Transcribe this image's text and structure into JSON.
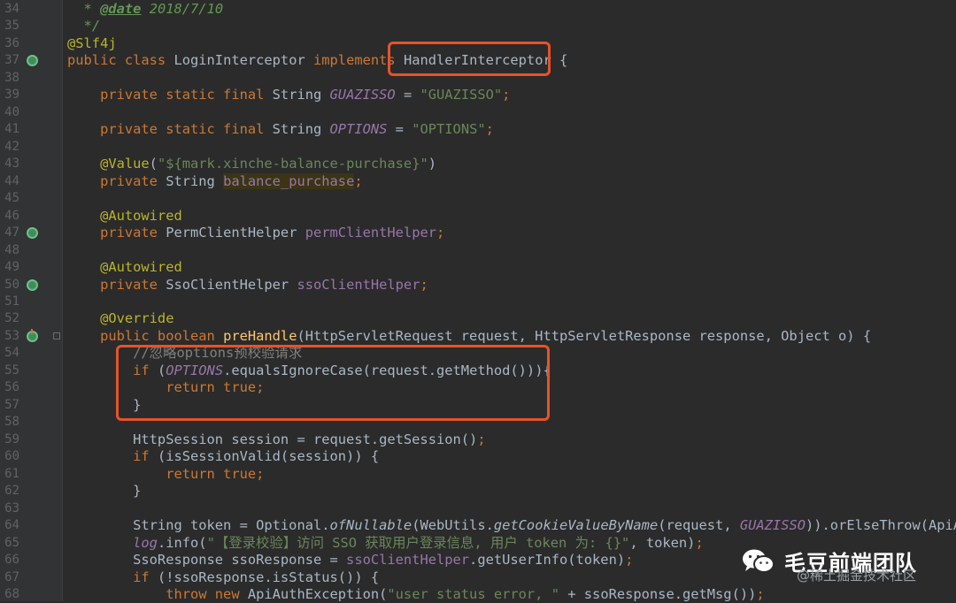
{
  "lines": [
    {
      "n": "34",
      "tokens": [
        {
          "t": "  ",
          "c": ""
        },
        {
          "t": "* ",
          "c": "doc"
        },
        {
          "t": "@date",
          "c": "doctag"
        },
        {
          "t": " 2018/7/10",
          "c": "doc"
        }
      ]
    },
    {
      "n": "35",
      "tokens": [
        {
          "t": "  ",
          "c": ""
        },
        {
          "t": "*/",
          "c": "doc"
        }
      ]
    },
    {
      "n": "36",
      "tokens": [
        {
          "t": "@Slf4j",
          "c": "ann"
        }
      ]
    },
    {
      "n": "37",
      "tokens": [
        {
          "t": "public class ",
          "c": "k"
        },
        {
          "t": "LoginInterceptor ",
          "c": ""
        },
        {
          "t": "implements ",
          "c": "k"
        },
        {
          "t": "HandlerInterceptor",
          "c": ""
        },
        {
          "t": " {",
          "c": ""
        }
      ]
    },
    {
      "n": "38",
      "tokens": []
    },
    {
      "n": "39",
      "tokens": [
        {
          "t": "    private static final ",
          "c": "k"
        },
        {
          "t": "String ",
          "c": ""
        },
        {
          "t": "GUAZISSO",
          "c": "sfld"
        },
        {
          "t": " = ",
          "c": ""
        },
        {
          "t": "\"GUAZISSO\"",
          "c": "str"
        },
        {
          "t": ";",
          "c": "k"
        }
      ]
    },
    {
      "n": "40",
      "tokens": []
    },
    {
      "n": "41",
      "tokens": [
        {
          "t": "    private static final ",
          "c": "k"
        },
        {
          "t": "String ",
          "c": ""
        },
        {
          "t": "OPTIONS",
          "c": "sfld"
        },
        {
          "t": " = ",
          "c": ""
        },
        {
          "t": "\"OPTIONS\"",
          "c": "str"
        },
        {
          "t": ";",
          "c": "k"
        }
      ]
    },
    {
      "n": "42",
      "tokens": []
    },
    {
      "n": "43",
      "tokens": [
        {
          "t": "    @Value",
          "c": "ann"
        },
        {
          "t": "(",
          "c": ""
        },
        {
          "t": "\"${mark.xinche-balance-purchase}\"",
          "c": "str"
        },
        {
          "t": ")",
          "c": ""
        }
      ]
    },
    {
      "n": "44",
      "tokens": [
        {
          "t": "    private ",
          "c": "k"
        },
        {
          "t": "String ",
          "c": ""
        },
        {
          "t": "balance_purchase",
          "c": "fld hl"
        },
        {
          "t": ";",
          "c": "k"
        }
      ]
    },
    {
      "n": "45",
      "tokens": []
    },
    {
      "n": "46",
      "tokens": [
        {
          "t": "    @Autowired",
          "c": "ann"
        }
      ]
    },
    {
      "n": "47",
      "tokens": [
        {
          "t": "    private ",
          "c": "k"
        },
        {
          "t": "PermClientHelper ",
          "c": ""
        },
        {
          "t": "permClientHelper",
          "c": "fld"
        },
        {
          "t": ";",
          "c": "k"
        }
      ]
    },
    {
      "n": "48",
      "tokens": []
    },
    {
      "n": "49",
      "tokens": [
        {
          "t": "    @Autowired",
          "c": "ann"
        }
      ]
    },
    {
      "n": "50",
      "tokens": [
        {
          "t": "    private ",
          "c": "k"
        },
        {
          "t": "SsoClientHelper ",
          "c": ""
        },
        {
          "t": "ssoClientHelper",
          "c": "fld"
        },
        {
          "t": ";",
          "c": "k"
        }
      ]
    },
    {
      "n": "51",
      "tokens": []
    },
    {
      "n": "52",
      "tokens": [
        {
          "t": "    @Override",
          "c": "ann"
        }
      ]
    },
    {
      "n": "53",
      "tokens": [
        {
          "t": "    public boolean ",
          "c": "k"
        },
        {
          "t": "preHandle",
          "c": "mth"
        },
        {
          "t": "(HttpServletRequest request, HttpServletResponse response, Object o) {",
          "c": ""
        }
      ]
    },
    {
      "n": "54",
      "tokens": [
        {
          "t": "        //忽略options预校验请求",
          "c": "cmt"
        }
      ]
    },
    {
      "n": "55",
      "tokens": [
        {
          "t": "        if ",
          "c": "k"
        },
        {
          "t": "(",
          "c": ""
        },
        {
          "t": "OPTIONS",
          "c": "sfld"
        },
        {
          "t": ".equalsIgnoreCase(request.getMethod())){",
          "c": ""
        }
      ]
    },
    {
      "n": "56",
      "tokens": [
        {
          "t": "            return true",
          "c": "k"
        },
        {
          "t": ";",
          "c": "k"
        }
      ]
    },
    {
      "n": "57",
      "tokens": [
        {
          "t": "        }",
          "c": ""
        }
      ]
    },
    {
      "n": "58",
      "tokens": []
    },
    {
      "n": "59",
      "tokens": [
        {
          "t": "        HttpSession session = request.getSession()",
          "c": ""
        },
        {
          "t": ";",
          "c": "k"
        }
      ]
    },
    {
      "n": "60",
      "tokens": [
        {
          "t": "        if ",
          "c": "k"
        },
        {
          "t": "(isSessionValid(session)) {",
          "c": ""
        }
      ]
    },
    {
      "n": "61",
      "tokens": [
        {
          "t": "            return true",
          "c": "k"
        },
        {
          "t": ";",
          "c": "k"
        }
      ]
    },
    {
      "n": "62",
      "tokens": [
        {
          "t": "        }",
          "c": ""
        }
      ]
    },
    {
      "n": "63",
      "tokens": []
    },
    {
      "n": "64",
      "tokens": [
        {
          "t": "        String token = Optional.",
          "c": ""
        },
        {
          "t": "ofNullable",
          "c": "smth"
        },
        {
          "t": "(WebUtils.",
          "c": ""
        },
        {
          "t": "getCookieValueByName",
          "c": "smth"
        },
        {
          "t": "(request, ",
          "c": ""
        },
        {
          "t": "GUAZISSO",
          "c": "sfld"
        },
        {
          "t": ")).orElseThrow(ApiAuth",
          "c": ""
        }
      ]
    },
    {
      "n": "65",
      "tokens": [
        {
          "t": "        ",
          "c": ""
        },
        {
          "t": "log",
          "c": "sfld"
        },
        {
          "t": ".info(",
          "c": ""
        },
        {
          "t": "\"【登录校验】访问 SSO 获取用户登录信息, 用户 token 为: {}\"",
          "c": "str"
        },
        {
          "t": ", token)",
          "c": ""
        },
        {
          "t": ";",
          "c": "k"
        }
      ]
    },
    {
      "n": "66",
      "tokens": [
        {
          "t": "        SsoResponse ssoResponse = ",
          "c": ""
        },
        {
          "t": "ssoClientHelper",
          "c": "fld"
        },
        {
          "t": ".getUserInfo(token)",
          "c": ""
        },
        {
          "t": ";",
          "c": "k"
        }
      ]
    },
    {
      "n": "67",
      "tokens": [
        {
          "t": "        if ",
          "c": "k"
        },
        {
          "t": "(!ssoResponse.isStatus()) {",
          "c": ""
        }
      ]
    },
    {
      "n": "68",
      "tokens": [
        {
          "t": "            throw new ",
          "c": "k"
        },
        {
          "t": "ApiAuthException(",
          "c": ""
        },
        {
          "t": "\"user status error, \"",
          "c": "str"
        },
        {
          "t": " + ssoResponse.getMsg())",
          "c": ""
        },
        {
          "t": ";",
          "c": "k"
        }
      ]
    }
  ],
  "gutter_icons": {
    "37": "impl",
    "47": "impl",
    "50": "impl",
    "53": "over"
  },
  "fold_lines": [
    "53"
  ],
  "colors": {
    "highlight_box": "#e8522a",
    "background": "#2b2b2b",
    "keyword": "#cc7832"
  },
  "watermark": {
    "icon": "wechat-icon",
    "text": "毛豆前端团队",
    "subtext": "@稀土掘金技术社区"
  }
}
